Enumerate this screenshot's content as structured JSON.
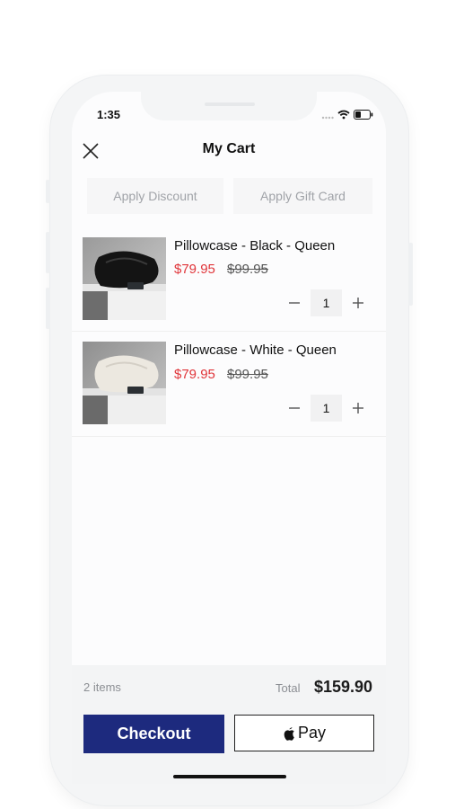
{
  "status_bar": {
    "time": "1:35"
  },
  "header": {
    "title": "My Cart",
    "close_icon": "close-icon"
  },
  "actions": {
    "apply_discount": "Apply Discount",
    "apply_gift_card": "Apply Gift Card"
  },
  "cart": {
    "items": [
      {
        "name": "Pillowcase - Black - Queen",
        "sale_price": "$79.95",
        "original_price": "$99.95",
        "quantity": "1",
        "image": "black-silk-pillowcase"
      },
      {
        "name": "Pillowcase - White - Queen",
        "sale_price": "$79.95",
        "original_price": "$99.95",
        "quantity": "1",
        "image": "white-silk-pillowcase"
      }
    ]
  },
  "summary": {
    "count": "2 items",
    "total_label": "Total",
    "total_value": "$159.90"
  },
  "buttons": {
    "checkout": "Checkout",
    "apple_pay": "Pay"
  },
  "colors": {
    "checkout_bg": "#1d2a7e",
    "sale_price": "#e0353a",
    "original_price": "#555555"
  }
}
